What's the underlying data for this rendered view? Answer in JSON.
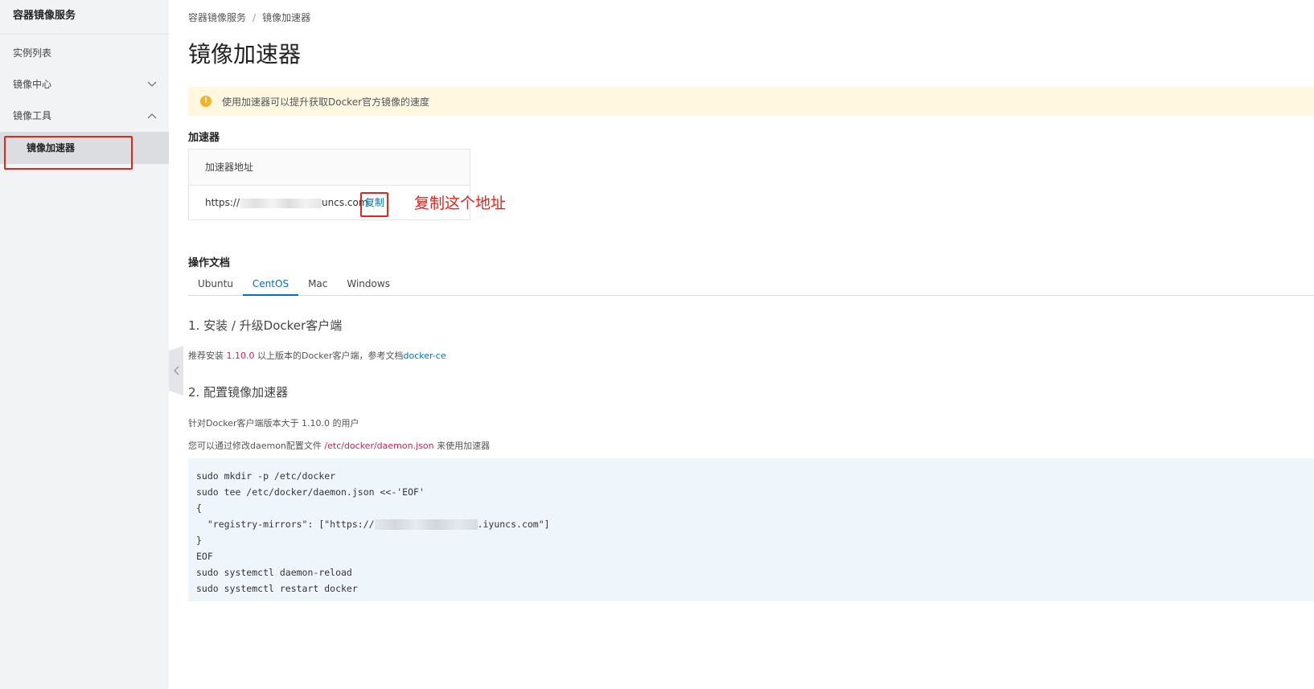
{
  "sidebar": {
    "title": "容器镜像服务",
    "items": [
      {
        "label": "实例列表"
      },
      {
        "label": "镜像中心"
      },
      {
        "label": "镜像工具"
      }
    ],
    "active_sub": "镜像加速器"
  },
  "breadcrumb": {
    "root": "容器镜像服务",
    "sep": "/",
    "current": "镜像加速器"
  },
  "page_title": "镜像加速器",
  "notice": {
    "icon": "!",
    "text": "使用加速器可以提升获取Docker官方镜像的速度"
  },
  "accelerator": {
    "section_title": "加速器",
    "column_header": "加速器地址",
    "address_prefix": "https://",
    "address_suffix": "uncs.com",
    "copy_label": "复制"
  },
  "annotation": "复制这个地址",
  "docs": {
    "section_title": "操作文档",
    "tabs": [
      "Ubuntu",
      "CentOS",
      "Mac",
      "Windows"
    ],
    "active_tab": "CentOS",
    "step1": {
      "title": "1. 安装 / 升级Docker客户端",
      "text_pre": "推荐安装 ",
      "version": "1.10.0",
      "text_mid": " 以上版本的Docker客户端，参考文档",
      "link": "docker-ce"
    },
    "step2": {
      "title": "2. 配置镜像加速器",
      "line1": "针对Docker客户端版本大于 1.10.0 的用户",
      "line2_pre": "您可以通过修改daemon配置文件 ",
      "line2_path": "/etc/docker/daemon.json",
      "line2_post": " 来使用加速器"
    },
    "code": {
      "line1": "sudo mkdir -p /etc/docker",
      "line2": "sudo tee /etc/docker/daemon.json <<-'EOF'",
      "line3": "{",
      "line4_pre": "  \"registry-mirrors\": [\"https://",
      "line4_post": ".iyuncs.com\"]",
      "line5": "}",
      "line6": "EOF",
      "line7": "sudo systemctl daemon-reload",
      "line8": "sudo systemctl restart docker"
    }
  },
  "colors": {
    "accent": "#0070cc",
    "annotation": "#e8231b",
    "notice_bg": "#fff7e0",
    "code_bg": "#eef5fb"
  }
}
